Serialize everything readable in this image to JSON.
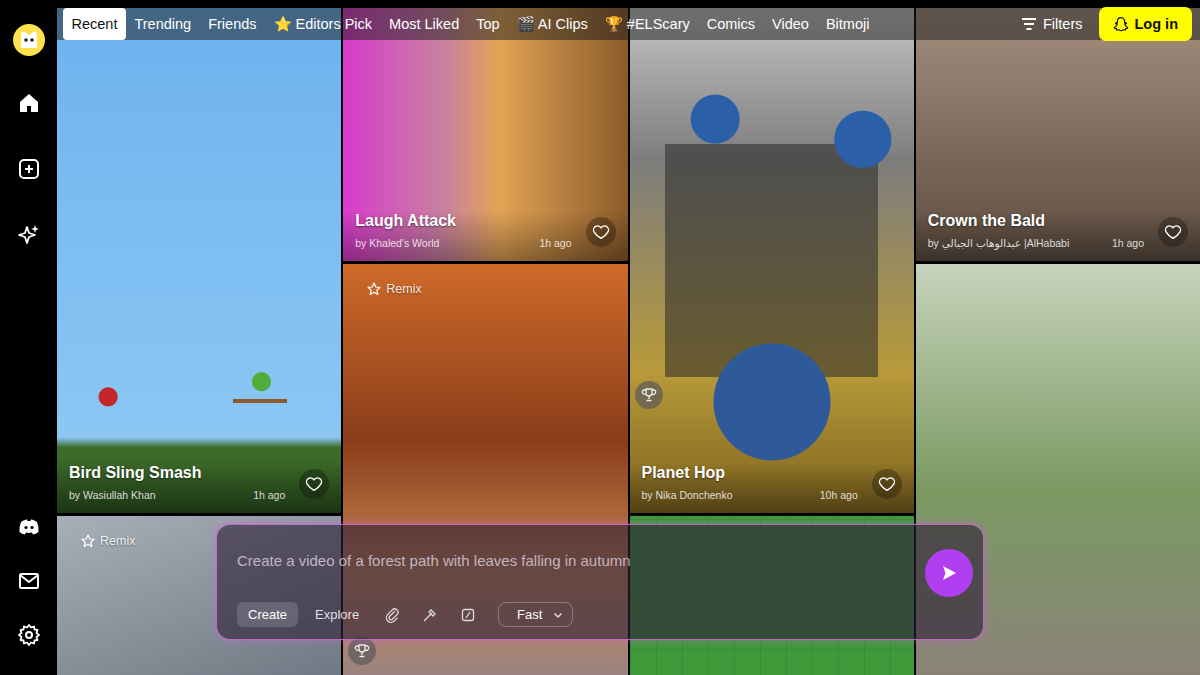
{
  "tabs": [
    {
      "label": "Recent",
      "selected": true
    },
    {
      "label": "Trending",
      "selected": false
    },
    {
      "label": "Friends",
      "selected": false
    },
    {
      "label": "⭐ Editors Pick",
      "selected": false
    },
    {
      "label": "Most Liked",
      "selected": false
    },
    {
      "label": "Top",
      "selected": false
    },
    {
      "label": "🎬 AI Clips",
      "selected": false
    },
    {
      "label": "🏆 #ELScary",
      "selected": false
    },
    {
      "label": "Comics",
      "selected": false
    },
    {
      "label": "Video",
      "selected": false
    },
    {
      "label": "Bitmoji",
      "selected": false
    }
  ],
  "filters": {
    "label": "Filters"
  },
  "login": {
    "label": "Log in"
  },
  "columns": [
    {
      "cards": [
        {
          "title": "Bird Sling Smash",
          "author": "by Wasiullah Khan",
          "time": "1h ago",
          "remix": false,
          "trophy": false
        },
        {
          "title": null,
          "author": null,
          "time": null,
          "remix": true,
          "trophy": false
        }
      ]
    },
    {
      "cards": [
        {
          "title": "Laugh Attack",
          "author": "by Khaled's World",
          "time": "1h ago",
          "remix": false,
          "trophy": false
        },
        {
          "title": null,
          "author": null,
          "time": null,
          "remix": true,
          "trophy": true
        }
      ]
    },
    {
      "cards": [
        {
          "title": "Planet Hop",
          "author": "by Nika Donchenko",
          "time": "10h ago",
          "remix": false,
          "trophy": true
        },
        {
          "title": null,
          "author": null,
          "time": null,
          "remix": false,
          "trophy": false
        }
      ]
    },
    {
      "cards": [
        {
          "title": "Crown the Bald",
          "author": "by عبدالوهاب الجبالي |AlHababi",
          "time": "1h ago",
          "remix": false,
          "trophy": false
        },
        {
          "title": null,
          "author": null,
          "time": null,
          "remix": false,
          "trophy": false
        }
      ]
    }
  ],
  "remix_label": "Remix",
  "prompt": {
    "placeholder": "Create a video of a forest path with leaves falling in autumn",
    "modes": [
      {
        "label": "Create",
        "selected": true
      },
      {
        "label": "Explore",
        "selected": false
      }
    ],
    "speed": "Fast"
  }
}
